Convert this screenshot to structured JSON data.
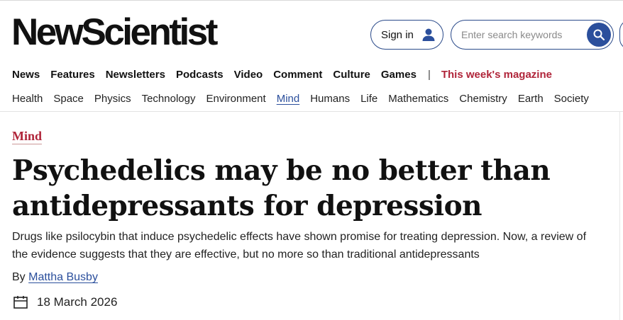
{
  "brand": {
    "logo_text": "NewScientist"
  },
  "header": {
    "signin_label": "Sign in",
    "search_placeholder": "Enter search keywords",
    "search_value": ""
  },
  "mainnav": {
    "items": [
      "News",
      "Features",
      "Newsletters",
      "Podcasts",
      "Video",
      "Comment",
      "Culture",
      "Games"
    ],
    "separator": "|",
    "magazine_label": "This week's magazine"
  },
  "subnav": {
    "items": [
      "Health",
      "Space",
      "Physics",
      "Technology",
      "Environment",
      "Mind",
      "Humans",
      "Life",
      "Mathematics",
      "Chemistry",
      "Earth",
      "Society"
    ],
    "active": "Mind"
  },
  "article": {
    "section": "Mind",
    "headline": "Psychedelics may be no better than antidepressants for depression",
    "standfirst": "Drugs like psilocybin that induce psychedelic effects have shown promise for treating depression. Now, a review of the evidence suggests that they are effective, but no more so than traditional antidepressants",
    "byline_prefix": "By",
    "author": "Mattha Busby",
    "date": "18 March 2026"
  },
  "icons": {
    "signin": "person-icon",
    "search": "search-icon",
    "date": "calendar-icon"
  },
  "colors": {
    "accent_blue": "#2b4f9c",
    "brand_red": "#b0253a"
  }
}
